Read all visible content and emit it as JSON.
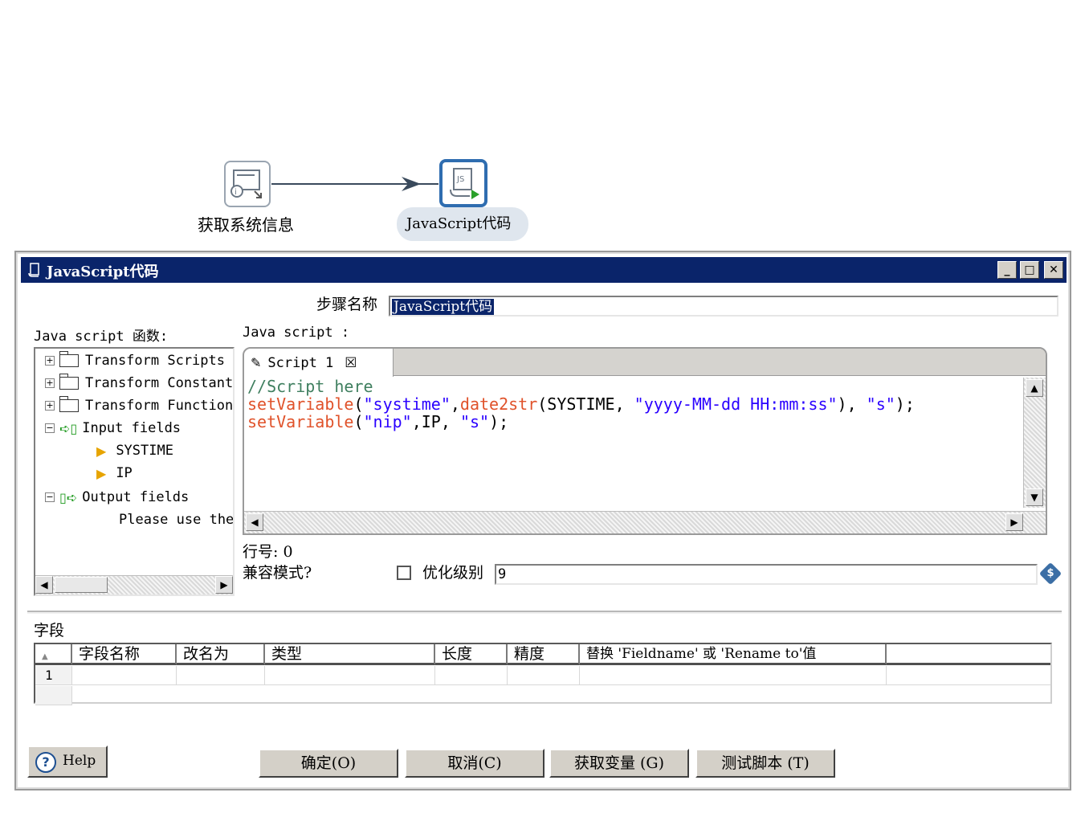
{
  "canvas": {
    "nodes": [
      {
        "label": "获取系统信息"
      },
      {
        "label": "JavaScript代码"
      }
    ]
  },
  "dialog": {
    "title": "JavaScript代码",
    "window_buttons": {
      "minimize": "_",
      "maximize": "□",
      "close": "✕"
    },
    "step_name_label": "步骤名称",
    "step_name_value": "JavaScript代码",
    "functions_label": "Java script 函数:",
    "script_label": "Java script :",
    "tree": {
      "items": [
        {
          "label": "Transform Scripts",
          "expander": "+"
        },
        {
          "label": "Transform Constants",
          "expander": "+"
        },
        {
          "label": "Transform Functions",
          "expander": "+"
        },
        {
          "label": "Input fields",
          "expander": "−"
        },
        {
          "label": "SYSTIME"
        },
        {
          "label": "IP"
        },
        {
          "label": "Output fields",
          "expander": "−"
        },
        {
          "label": "Please use the"
        }
      ]
    },
    "editor": {
      "tab_label": "Script 1",
      "tab_close": "☒",
      "lines": [
        [
          {
            "t": "comment",
            "v": "//Script here"
          }
        ],
        [
          {
            "t": "fn",
            "v": "setVariable"
          },
          {
            "t": "plain",
            "v": "("
          },
          {
            "t": "str",
            "v": "\"systime\""
          },
          {
            "t": "plain",
            "v": ","
          },
          {
            "t": "fn",
            "v": "date2str"
          },
          {
            "t": "plain",
            "v": "(SYSTIME, "
          },
          {
            "t": "str",
            "v": "\"yyyy-MM-dd HH:mm:ss\""
          },
          {
            "t": "plain",
            "v": "), "
          },
          {
            "t": "str",
            "v": "\"s\""
          },
          {
            "t": "plain",
            "v": ");"
          }
        ],
        [
          {
            "t": "fn",
            "v": "setVariable"
          },
          {
            "t": "plain",
            "v": "("
          },
          {
            "t": "str",
            "v": "\"nip\""
          },
          {
            "t": "plain",
            "v": ",IP, "
          },
          {
            "t": "str",
            "v": "\"s\""
          },
          {
            "t": "plain",
            "v": ");"
          }
        ]
      ]
    },
    "line_number_label": "行号: 0",
    "compat_label": "兼容模式?",
    "opt_level_label": "优化级别",
    "opt_level_value": "9",
    "fields_label": "字段",
    "table": {
      "headers": [
        "",
        "字段名称",
        "改名为",
        "类型",
        "长度",
        "精度",
        "替换 'Fieldname' 或 'Rename to'值",
        ""
      ],
      "rows": [
        [
          "1",
          "",
          "",
          "",
          "",
          "",
          "",
          ""
        ]
      ]
    },
    "buttons": {
      "help": "Help",
      "ok": "确定(O)",
      "cancel": "取消(C)",
      "get_vars": "获取变量 (G)",
      "test": "测试脚本 (T)"
    }
  }
}
